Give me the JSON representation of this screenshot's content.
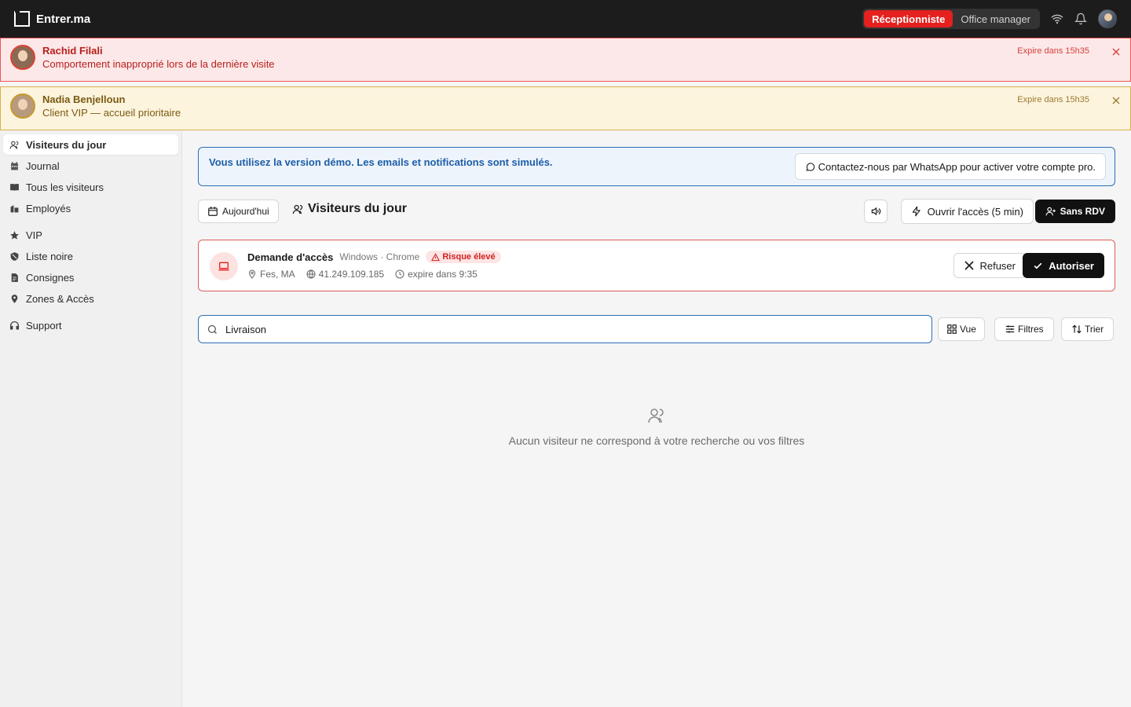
{
  "app": {
    "brand": "Entrer.ma"
  },
  "topbar": {
    "roles": [
      "Réceptionniste",
      "Office manager"
    ],
    "active_role": "Réceptionniste"
  },
  "alerts": [
    {
      "name": "Rachid Filali",
      "message": "Comportement inapproprié lors de la dernière visite",
      "expires": "Expire dans 15h35",
      "severity": "blacklist"
    },
    {
      "name": "Nadia Benjelloun",
      "message": "Client VIP — accueil prioritaire",
      "expires": "Expire dans 15h35",
      "severity": "vip"
    }
  ],
  "sidebar": {
    "items": [
      {
        "label": "Visiteurs du jour",
        "icon": "users-icon",
        "active": true
      },
      {
        "label": "Journal",
        "icon": "calendar-icon"
      },
      {
        "label": "Tous les visiteurs",
        "icon": "book-icon"
      },
      {
        "label": "Employés",
        "icon": "building-icon"
      },
      {
        "label": "VIP",
        "icon": "star-icon"
      },
      {
        "label": "Liste noire",
        "icon": "shield-icon"
      },
      {
        "label": "Consignes",
        "icon": "document-icon"
      },
      {
        "label": "Zones & Accès",
        "icon": "map-pin-icon"
      },
      {
        "label": "Support",
        "icon": "headset-icon"
      }
    ]
  },
  "demo_banner": {
    "text": "Vous utilisez la version démo. Les emails et notifications sont simulés.",
    "cta": "Contactez-nous par WhatsApp pour activer votre compte pro."
  },
  "toolbar": {
    "date_label": "Aujourd'hui",
    "title": "Visiteurs du jour",
    "open_access_label": "Ouvrir l'accès (5 min)",
    "walkin_label": "Sans RDV"
  },
  "access_request": {
    "title": "Demande d'accès",
    "device": "Windows · Chrome",
    "risk": "Risque élevé",
    "location": "Fes, MA",
    "ip": "41.249.109.185",
    "expiry": "expire dans 9:35",
    "refuse_label": "Refuser",
    "authorize_label": "Autoriser"
  },
  "search": {
    "value": "Livraison",
    "view_label": "Vue",
    "filters_label": "Filtres",
    "sort_label": "Trier"
  },
  "empty_state": {
    "message": "Aucun visiteur ne correspond à votre recherche ou vos filtres"
  },
  "colors": {
    "accent_red": "#e4211f",
    "info_blue": "#2a6fb8",
    "topbar_bg": "#1c1c1c"
  }
}
